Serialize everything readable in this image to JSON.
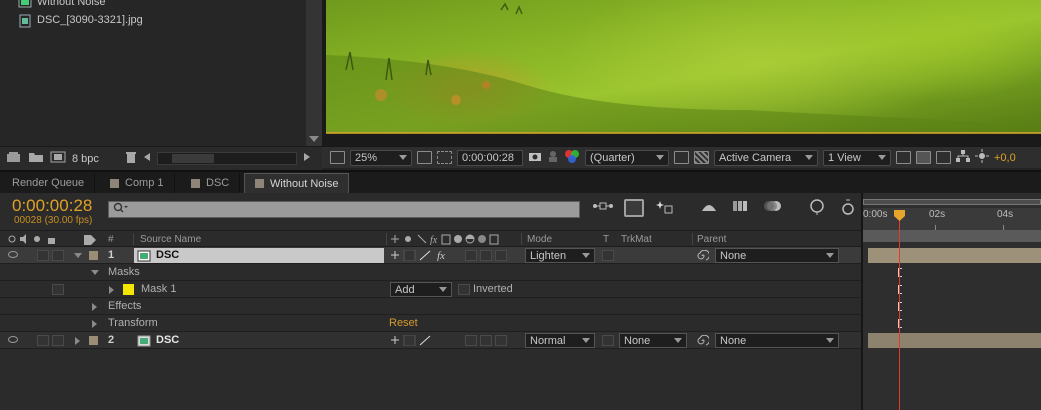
{
  "project": {
    "items": [
      {
        "name": "Without Noise"
      },
      {
        "name": "DSC_[3090-3321].jpg"
      }
    ],
    "footer": {
      "bpc": "8 bpc"
    }
  },
  "viewer": {
    "zoom": "25%",
    "timecode": "0:00:00:28",
    "resolution": "(Quarter)",
    "camera": "Active Camera",
    "view": "1 View",
    "exposure": "+0,0"
  },
  "tabs": [
    {
      "label": "Render Queue",
      "swatch": false,
      "active": false
    },
    {
      "label": "Comp 1",
      "swatch": true,
      "active": false
    },
    {
      "label": "DSC",
      "swatch": true,
      "active": false
    },
    {
      "label": "Without Noise",
      "swatch": true,
      "active": true
    }
  ],
  "timeline": {
    "timecode": "0:00:00:28",
    "fps": "00028 (30.00 fps)",
    "search_placeholder": "",
    "columns": {
      "hash": "#",
      "source": "Source Name",
      "mode": "Mode",
      "t": "T",
      "trkmat": "TrkMat",
      "parent": "Parent"
    },
    "rows": [
      {
        "type": "layer",
        "num": "1",
        "name": "DSC",
        "mode": "Lighten",
        "trkmat": "",
        "parent": "None"
      },
      {
        "type": "group",
        "label": "Masks"
      },
      {
        "type": "mask",
        "label": "Mask 1",
        "mode": "Add",
        "inverted": "Inverted"
      },
      {
        "type": "group",
        "label": "Effects"
      },
      {
        "type": "group",
        "label": "Transform",
        "reset": "Reset"
      },
      {
        "type": "layer",
        "num": "2",
        "name": "DSC",
        "mode": "Normal",
        "trkmat": "None",
        "parent": "None"
      }
    ],
    "ruler": {
      "start": "0:00s",
      "mid": "02s",
      "end": "04s"
    }
  },
  "colors": {
    "accent": "#e0a226",
    "cti": "#e23b2b",
    "mask_swatch": "#f5e600",
    "label_swatch": "#9b8c76"
  }
}
